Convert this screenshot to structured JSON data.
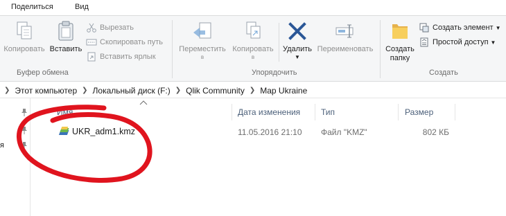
{
  "tabs": {
    "share": "Поделиться",
    "view": "Вид"
  },
  "ribbon": {
    "clipboard": {
      "copy": "Копировать",
      "paste": "Вставить",
      "cut": "Вырезать",
      "copy_path": "Скопировать путь",
      "paste_shortcut": "Вставить ярлык",
      "label": "Буфер обмена"
    },
    "organize": {
      "move_to_line1": "Переместить",
      "move_to_line2": "в",
      "copy_to_line1": "Копировать",
      "copy_to_line2": "в",
      "delete": "Удалить",
      "rename": "Переименовать",
      "label": "Упорядочить"
    },
    "new": {
      "new_folder_line1": "Создать",
      "new_folder_line2": "папку",
      "new_item": "Создать элемент",
      "easy_access": "Простой доступ",
      "label": "Создать"
    }
  },
  "breadcrumb": [
    "Этот компьютер",
    "Локальный диск (F:)",
    "Qlik Community",
    "Map Ukraine"
  ],
  "nav": {
    "stub": "я"
  },
  "columns": {
    "name": "Имя",
    "date": "Дата изменения",
    "type": "Тип",
    "size": "Размер"
  },
  "files": [
    {
      "name": "UKR_adm1.kmz",
      "date": "11.05.2016 21:10",
      "type": "Файл \"KMZ\"",
      "size": "802 КБ"
    }
  ],
  "icons": {
    "copy": "copy-icon",
    "paste": "clipboard-icon",
    "cut": "scissors-icon",
    "copy_path": "path-icon",
    "paste_shortcut": "shortcut-icon",
    "move": "move-icon",
    "copy_to": "copy-to-icon",
    "delete": "x-icon",
    "rename": "rename-icon",
    "new_folder": "folder-icon",
    "new_item": "new-item-icon",
    "easy_access": "easy-access-icon",
    "pin": "pin-icon",
    "file": "kmz-file-icon"
  },
  "colors": {
    "annotation": "#e0141e",
    "header_text": "#4c607a",
    "ribbon_bg": "#f5f6f7",
    "delete_icon": "#2b5797"
  }
}
